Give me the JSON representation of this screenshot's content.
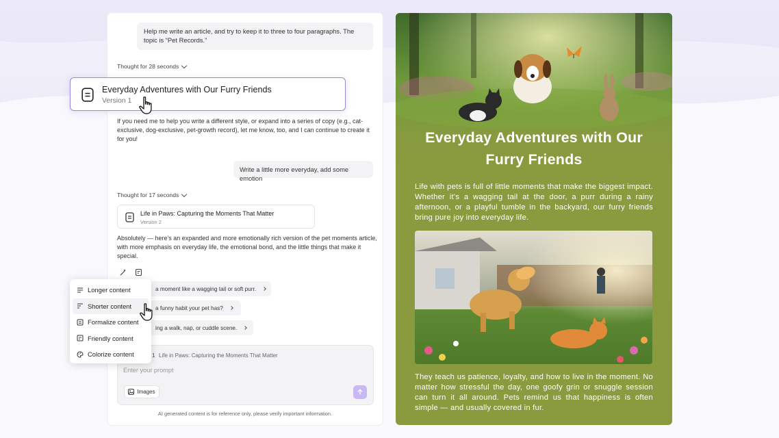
{
  "chat": {
    "user_message_1": "Help me write an article, and try to keep it to three to four paragraphs. The topic is “Pet Records.”",
    "thought_1": "Thought for 28 seconds",
    "version_card": {
      "title": "Everyday Adventures with Our Furry Friends",
      "version": "Version 1"
    },
    "assistant_message_1": "If you need me to help you write a different style, or expand into a series of copy (e.g., cat-exclusive, dog-exclusive, pet-growth record), let me know, too, and I can continue to create it for you!",
    "user_message_2": "Write a little more everyday, add some emotion",
    "thought_2": "Thought for 17 seconds",
    "doc_card": {
      "title": "Life in Paws: Capturing the Moments That Matter",
      "version": "Version 2"
    },
    "assistant_message_2": "Absolutely — here's an expanded and more emotionally rich version of the pet moments article, with more emphasis on everyday life, the emotional bond, and the little things that make it special.",
    "suggestions": [
      "a moment like a wagging tail or soft purr.",
      "a funny habit your pet has?",
      "ing a walk, nap, or cuddle scene."
    ],
    "input": {
      "reference_number": "1",
      "reference_title": "Life in Paws: Capturing the Moments That Matter",
      "placeholder": "Enter your prompt",
      "images_label": "Images"
    },
    "disclaimer": "AI generated content is for reference only, please verify important information."
  },
  "menu": {
    "items": [
      "Longer content",
      "Shorter content",
      "Formalize content",
      "Friendly content",
      "Colorize content"
    ],
    "hovered": "Shorter content"
  },
  "article": {
    "title": "Everyday Adventures with Our Furry Friends",
    "paragraph_1": "Life with pets is full of little moments that make the biggest impact. Whether it’s a wagging tail at the door, a purr during a rainy afternoon, or a playful tumble in the backyard, our furry friends bring pure joy into everyday life.",
    "paragraph_2": "They teach us patience, loyalty, and how to live in the moment. No matter how stressful the day, one goofy grin or snuggle session can turn it all around. Pets remind us that happiness is often simple — and usually covered in fur.",
    "background_color": "#8a9a3e"
  },
  "colors": {
    "accent": "#9a86dd",
    "send": "#c7b8f3"
  }
}
